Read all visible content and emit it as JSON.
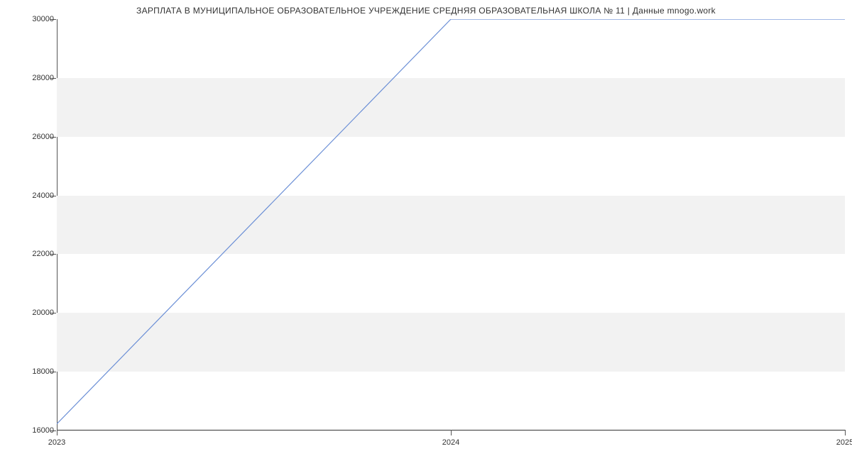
{
  "chart_data": {
    "type": "line",
    "title": "ЗАРПЛАТА В МУНИЦИПАЛЬНОЕ ОБРАЗОВАТЕЛЬНОЕ УЧРЕЖДЕНИЕ СРЕДНЯЯ ОБРАЗОВАТЕЛЬНАЯ ШКОЛА № 11 | Данные mnogo.work",
    "x": [
      2023,
      2024,
      2025
    ],
    "values": [
      16200,
      30000,
      30000
    ],
    "xlabel": "",
    "ylabel": "",
    "xlim": [
      2023,
      2025
    ],
    "ylim": [
      16000,
      30000
    ],
    "x_ticks": [
      2023,
      2024,
      2025
    ],
    "y_ticks": [
      16000,
      18000,
      20000,
      22000,
      24000,
      26000,
      28000,
      30000
    ],
    "line_color": "#6b8fd6",
    "band_color": "#f2f2f2"
  }
}
